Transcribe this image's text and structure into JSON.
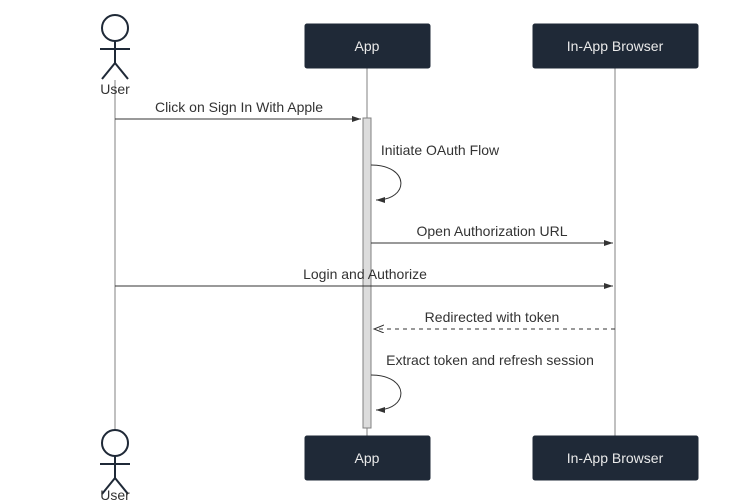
{
  "chart_data": {
    "type": "sequence",
    "participants": [
      {
        "id": "user",
        "kind": "actor",
        "label": "User"
      },
      {
        "id": "app",
        "kind": "participant",
        "label": "App"
      },
      {
        "id": "browser",
        "kind": "participant",
        "label": "In-App Browser"
      }
    ],
    "messages": [
      {
        "from": "user",
        "to": "app",
        "label": "Click on Sign In With Apple",
        "style": "solid"
      },
      {
        "from": "app",
        "to": "app",
        "label": "Initiate OAuth Flow",
        "style": "solid_self"
      },
      {
        "from": "app",
        "to": "browser",
        "label": "Open Authorization URL",
        "style": "solid"
      },
      {
        "from": "user",
        "to": "browser",
        "label": "Login and Authorize",
        "style": "solid"
      },
      {
        "from": "browser",
        "to": "app",
        "label": "Redirected with token",
        "style": "dashed"
      },
      {
        "from": "app",
        "to": "app",
        "label": "Extract token and refresh session",
        "style": "solid_self"
      }
    ]
  },
  "colors": {
    "box_fill": "#1f2937",
    "box_text": "#eaeaea",
    "actor_stroke": "#1f2937",
    "line": "#808080",
    "label": "#333333",
    "lifeline": "#808080",
    "activation": "#dcdcdc"
  }
}
